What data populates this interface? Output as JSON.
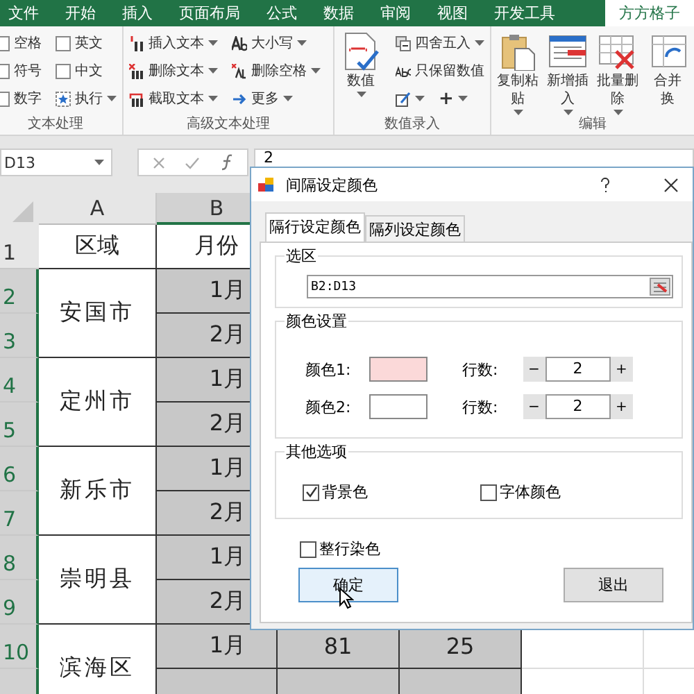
{
  "ribbon": {
    "tabs": [
      {
        "label": "文件",
        "selected": false
      },
      {
        "label": "开始",
        "selected": false
      },
      {
        "label": "插入",
        "selected": false
      },
      {
        "label": "页面布局",
        "selected": false
      },
      {
        "label": "公式",
        "selected": false
      },
      {
        "label": "数据",
        "selected": false
      },
      {
        "label": "审阅",
        "selected": false
      },
      {
        "label": "视图",
        "selected": false
      },
      {
        "label": "开发工具",
        "selected": false
      },
      {
        "label": "方方格子",
        "selected": true
      }
    ],
    "groups": [
      {
        "label": "文本处理",
        "columns": [
          [
            {
              "kind": "checkbox",
              "label": "空格",
              "checked": false
            },
            {
              "kind": "checkbox",
              "label": "符号",
              "checked": false
            },
            {
              "kind": "checkbox",
              "label": "数字",
              "checked": false
            }
          ],
          [
            {
              "kind": "checkbox",
              "label": "英文",
              "checked": false
            },
            {
              "kind": "checkbox",
              "label": "中文",
              "checked": false
            },
            {
              "kind": "small",
              "label": "执行",
              "dropdown": true
            }
          ]
        ]
      },
      {
        "label": "高级文本处理",
        "columns": [
          [
            {
              "kind": "small",
              "label": "插入文本",
              "dropdown": true
            },
            {
              "kind": "small",
              "label": "删除文本",
              "dropdown": true
            },
            {
              "kind": "small",
              "label": "截取文本",
              "dropdown": true
            }
          ],
          [
            {
              "kind": "small",
              "label": "大小写",
              "dropdown": true
            },
            {
              "kind": "small",
              "label": "删除空格",
              "dropdown": true
            },
            {
              "kind": "small",
              "label": "更多",
              "dropdown": true
            }
          ]
        ]
      },
      {
        "label": "数值录入",
        "columns": [
          [
            {
              "kind": "big",
              "lines": [
                "数值"
              ],
              "dropdown": true
            }
          ],
          [
            {
              "kind": "small",
              "label": "四舍五入",
              "dropdown": true
            },
            {
              "kind": "small",
              "label": "只保留数值",
              "dropdown": false
            },
            {
              "kind": "row",
              "items": [
                {
                  "kind": "small",
                  "dropdown": true
                },
                {
                  "kind": "text",
                  "label": "+",
                  "dropdown": true
                }
              ]
            }
          ]
        ]
      },
      {
        "label": "编辑",
        "columns": [
          [
            {
              "kind": "big",
              "lines": [
                "复制粘",
                "贴"
              ],
              "dropdown": true
            }
          ],
          [
            {
              "kind": "big",
              "lines": [
                "新增插",
                "入"
              ],
              "dropdown": true
            }
          ],
          [
            {
              "kind": "big",
              "lines": [
                "批量删",
                "除"
              ],
              "dropdown": true
            }
          ],
          [
            {
              "kind": "big",
              "lines": [
                "合并",
                "换"
              ],
              "dropdown": false
            }
          ]
        ]
      }
    ]
  },
  "formula_bar": {
    "name_box": "D13",
    "value": "2"
  },
  "sheet": {
    "column_headers": [
      "A",
      "B"
    ],
    "row_numbers": [
      "1",
      "2",
      "3",
      "4",
      "5",
      "6",
      "7",
      "8",
      "9",
      "10"
    ],
    "header_row": [
      "区域",
      "月份"
    ],
    "regions": [
      {
        "name": "安国市",
        "months": [
          "1月",
          "2月"
        ]
      },
      {
        "name": "定州市",
        "months": [
          "1月",
          "2月"
        ]
      },
      {
        "name": "新乐市",
        "months": [
          "1月",
          "2月"
        ]
      },
      {
        "name": "崇明县",
        "months": [
          "1月",
          "2月"
        ]
      },
      {
        "name": "滨海区",
        "months": [
          "1月"
        ]
      }
    ],
    "last_row_values": [
      "81",
      "25"
    ]
  },
  "dialog": {
    "title": "间隔设定颜色",
    "tabs": [
      {
        "label": "隔行设定颜色",
        "selected": true
      },
      {
        "label": "隔列设定颜色",
        "selected": false
      }
    ],
    "range_group": {
      "legend": "选区",
      "value": "B2:D13"
    },
    "color_group": {
      "legend": "颜色设置",
      "rows": [
        {
          "label": "颜色1:",
          "color": "#fbd9d9",
          "count_label": "行数:",
          "decrement": "−",
          "count": "2",
          "increment": "+"
        },
        {
          "label": "颜色2:",
          "color": "#ffffff",
          "count_label": "行数:",
          "decrement": "−",
          "count": "2",
          "increment": "+"
        }
      ]
    },
    "options_group": {
      "legend": "其他选项",
      "options": [
        {
          "label": "背景色",
          "checked": true
        },
        {
          "label": "字体颜色",
          "checked": false
        }
      ]
    },
    "whole_row": {
      "label": "整行染色",
      "checked": false
    },
    "buttons": [
      {
        "label": "确定",
        "focused": true
      },
      {
        "label": "退出",
        "focused": false
      }
    ]
  }
}
